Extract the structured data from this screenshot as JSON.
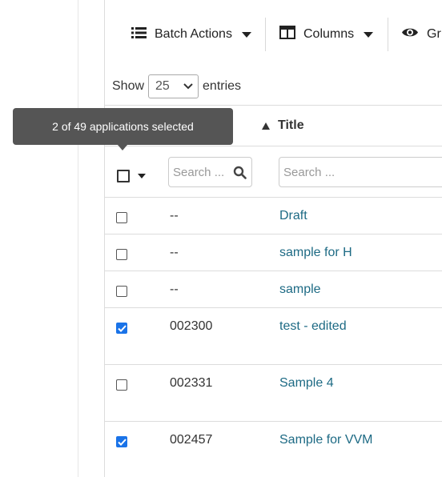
{
  "toolbar": {
    "batch_actions_label": "Batch Actions",
    "columns_label": "Columns",
    "group_label": "Gr",
    "icons": [
      "list-icon",
      "columns-icon",
      "eye-icon"
    ]
  },
  "length_menu": {
    "show_label": "Show",
    "selected_value": "25",
    "entries_label": "entries"
  },
  "table": {
    "headers": {
      "title": "Title"
    },
    "filters": {
      "number_placeholder": "Search ...",
      "title_placeholder": "Search ..."
    },
    "rows": [
      {
        "number": "--",
        "title": "Draft",
        "checked": false
      },
      {
        "number": "--",
        "title": "sample for H",
        "checked": false
      },
      {
        "number": "--",
        "title": "sample",
        "checked": false
      },
      {
        "number": "002300",
        "title": "test - edited",
        "checked": true
      },
      {
        "number": "002331",
        "title": "Sample 4",
        "checked": false
      },
      {
        "number": "002457",
        "title": "Sample for VVM",
        "checked": true
      }
    ]
  },
  "tooltip": {
    "text": "2 of 49 applications selected"
  },
  "colors": {
    "link": "#1d6a84",
    "checkbox_checked": "#1a73e8",
    "tooltip_bg": "#555555"
  }
}
